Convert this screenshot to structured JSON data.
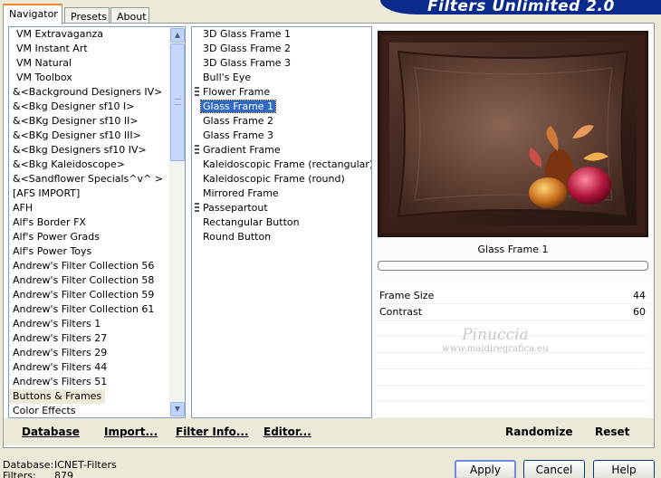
{
  "app": {
    "title": "Filters Unlimited 2.0"
  },
  "tabs": [
    {
      "label": "Navigator",
      "active": true
    },
    {
      "label": "Presets",
      "active": false
    },
    {
      "label": "About",
      "active": false
    }
  ],
  "categories": [
    "VM Extravaganza",
    "VM Instant Art",
    "VM Natural",
    "VM Toolbox",
    "&<Background Designers IV>",
    "&<Bkg Designer sf10 I>",
    "&<BKg Designer sf10 II>",
    "&<BKg Designer sf10 III>",
    "&<Bkg Designers sf10 IV>",
    "&<Bkg Kaleidoscope>",
    "&<Sandflower Specials^v^ >",
    "[AFS IMPORT]",
    "AFH",
    "Alf's Border FX",
    "Alf's Power Grads",
    "Alf's Power Toys",
    "Andrew's Filter Collection 56",
    "Andrew's Filter Collection 58",
    "Andrew's Filter Collection 59",
    "Andrew's Filter Collection 61",
    "Andrew's Filters 1",
    "Andrew's Filters 27",
    "Andrew's Filters 29",
    "Andrew's Filters 44",
    "Andrew's Filters 51",
    "Buttons & Frames",
    "Color Effects"
  ],
  "selected_category": "Buttons & Frames",
  "filters": [
    {
      "label": "3D Glass Frame 1",
      "marker": false
    },
    {
      "label": "3D Glass Frame 2",
      "marker": false
    },
    {
      "label": "3D Glass Frame 3",
      "marker": false
    },
    {
      "label": "Bull's Eye",
      "marker": false
    },
    {
      "label": "Flower Frame",
      "marker": true
    },
    {
      "label": "Glass Frame 1",
      "marker": false,
      "selected": true
    },
    {
      "label": "Glass Frame 2",
      "marker": false
    },
    {
      "label": "Glass Frame 3",
      "marker": false
    },
    {
      "label": "Gradient Frame",
      "marker": true
    },
    {
      "label": "Kaleidoscopic Frame (rectangular)",
      "marker": false
    },
    {
      "label": "Kaleidoscopic Frame (round)",
      "marker": false
    },
    {
      "label": "Mirrored Frame",
      "marker": false
    },
    {
      "label": "Passepartout",
      "marker": true
    },
    {
      "label": "Rectangular Button",
      "marker": false
    },
    {
      "label": "Round Button",
      "marker": false
    }
  ],
  "preview": {
    "filter_name": "Glass Frame 1",
    "progress": 0
  },
  "parameters": [
    {
      "name": "Frame Size",
      "value": "44"
    },
    {
      "name": "Contrast",
      "value": "60"
    }
  ],
  "watermark": {
    "line1": "Pinuccia",
    "line2": "www.maidiregrafica.eu"
  },
  "inner_buttons": {
    "database": "Database",
    "import": "Import...",
    "filter_info": "Filter Info...",
    "editor": "Editor...",
    "randomize": "Randomize",
    "reset": "Reset"
  },
  "status": {
    "database_label": "Database:",
    "database_value": "ICNET-Filters",
    "filters_label": "Filters:",
    "filters_value": "879"
  },
  "dialog_buttons": {
    "apply": "Apply",
    "cancel": "Cancel",
    "help": "Help"
  },
  "colors": {
    "banner": "#0a2a8c",
    "selection": "#316ac5",
    "tab_accent": "#e68b2c"
  }
}
